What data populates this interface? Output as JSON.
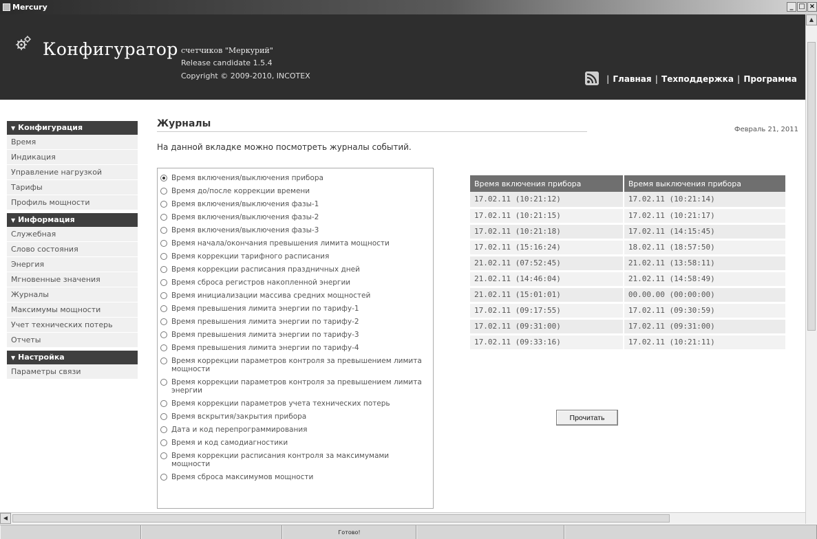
{
  "window": {
    "title": "Mercury",
    "controls": [
      "_",
      "□",
      "×"
    ]
  },
  "header": {
    "title": "Конфигуратор",
    "subtitle": "счетчиков \"Меркурий\"",
    "release": "Release candidate 1.5.4",
    "copyright": "Copyright © 2009-2010, INCOTEX",
    "nav": [
      "Главная",
      "Техподдержка",
      "Программа"
    ]
  },
  "sidebar": {
    "sections": [
      {
        "title": "Конфигурация",
        "items": [
          "Время",
          "Индикация",
          "Управление нагрузкой",
          "Тарифы",
          "Профиль мощности"
        ]
      },
      {
        "title": "Информация",
        "items": [
          "Служебная",
          "Слово состояния",
          "Энергия",
          "Мгновенные значения",
          "Журналы",
          "Максимумы мощности",
          "Учет технических потерь",
          "Отчеты"
        ]
      },
      {
        "title": "Настройка",
        "items": [
          "Параметры связи"
        ]
      }
    ]
  },
  "main": {
    "title": "Журналы",
    "date": "Февраль 21, 2011",
    "intro": "На данной вкладке можно посмотреть журналы событий.",
    "journals": [
      "Время включения/выключения прибора",
      "Время до/после коррекции времени",
      "Время включения/выключения фазы-1",
      "Время включения/выключения фазы-2",
      "Время включения/выключения фазы-3",
      "Время начала/окончания превышения лимита мощности",
      "Время коррекции тарифного расписания",
      "Время коррекции расписания праздничных дней",
      "Время сброса регистров накопленной энергии",
      "Время инициализации массива средних мощностей",
      "Время превышения лимита энергии по тарифу-1",
      "Время превышения лимита энергии по тарифу-2",
      "Время превышения лимита энергии по тарифу-3",
      "Время превышения лимита энергии по тарифу-4",
      "Время коррекции параметров контроля за превышением лимита мощности",
      "Время коррекции параметров контроля за превышением лимита энергии",
      "Время коррекции параметров учета технических потерь",
      "Время вскрытия/закрытия прибора",
      "Дата и код перепрограммирования",
      "Время и код самодиагностики",
      "Время коррекции расписания контроля за максимумами мощности",
      "Время сброса максимумов мощности"
    ],
    "selected_journal": 0,
    "table": {
      "headers": [
        "Время включения прибора",
        "Время выключения прибора"
      ],
      "rows": [
        [
          "17.02.11 (10:21:12)",
          "17.02.11 (10:21:14)"
        ],
        [
          "17.02.11 (10:21:15)",
          "17.02.11 (10:21:17)"
        ],
        [
          "17.02.11 (10:21:18)",
          "17.02.11 (14:15:45)"
        ],
        [
          "17.02.11 (15:16:24)",
          "18.02.11 (18:57:50)"
        ],
        [
          "21.02.11 (07:52:45)",
          "21.02.11 (13:58:11)"
        ],
        [
          "21.02.11 (14:46:04)",
          "21.02.11 (14:58:49)"
        ],
        [
          "21.02.11 (15:01:01)",
          "00.00.00 (00:00:00)"
        ],
        [
          "17.02.11 (09:17:55)",
          "17.02.11 (09:30:59)"
        ],
        [
          "17.02.11 (09:31:00)",
          "17.02.11 (09:31:00)"
        ],
        [
          "17.02.11 (09:33:16)",
          "17.02.11 (10:21:11)"
        ]
      ]
    },
    "read_button": "Прочитать"
  },
  "statusbar": {
    "status": "Готово!"
  },
  "icons": {
    "app": "app-icon",
    "gear": "gears-icon",
    "rss": "rss-icon"
  }
}
